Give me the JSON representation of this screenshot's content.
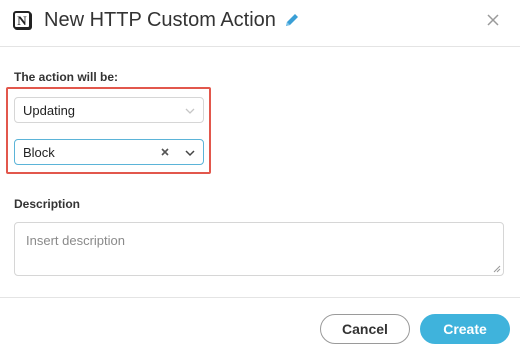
{
  "dialog": {
    "title": "New HTTP Custom Action",
    "app_icon_letter": "N",
    "icons": {
      "app": "notion-icon",
      "edit": "pencil-icon",
      "close": "close-icon"
    }
  },
  "action": {
    "label": "The action will be:",
    "type_select": {
      "value": "Updating"
    },
    "mode_select": {
      "value": "Block"
    }
  },
  "description": {
    "label": "Description",
    "placeholder": "Insert description"
  },
  "footer": {
    "cancel_label": "Cancel",
    "create_label": "Create"
  },
  "colors": {
    "accent": "#3fb3dc",
    "highlight_border": "#e2574c",
    "pencil": "#3a9fd6"
  }
}
